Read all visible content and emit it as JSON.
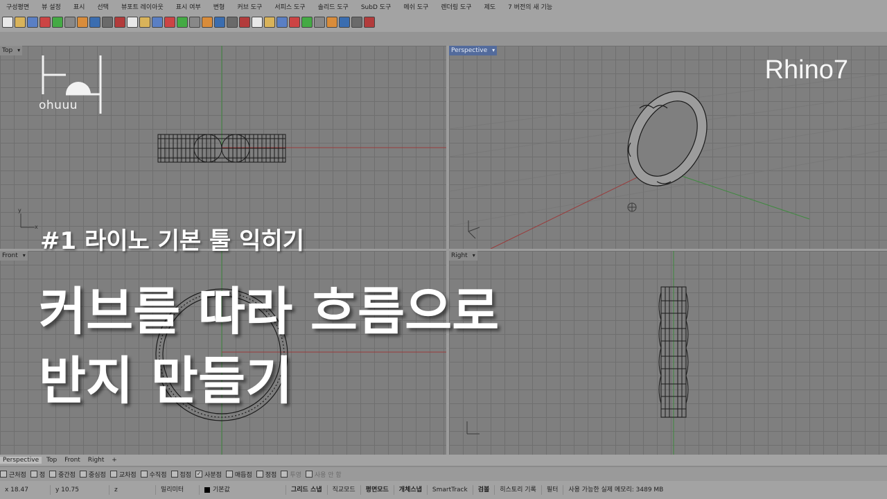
{
  "menu": [
    "구성평면",
    "뷰 설정",
    "표시",
    "선택",
    "뷰포트 레이아웃",
    "표시 여부",
    "변형",
    "커브 도구",
    "서피스 도구",
    "솔리드 도구",
    "SubD 도구",
    "메쉬 도구",
    "렌더링 도구",
    "제도",
    "7 버전의 새 기능"
  ],
  "toolbar_icons": [
    "new-icon",
    "open-icon",
    "save-icon",
    "print-icon",
    "cut-icon",
    "copy-icon",
    "paste-icon",
    "undo-icon",
    "pan-icon",
    "move-icon",
    "zoom-icon",
    "zoom-window-icon",
    "zoom-extents-icon",
    "zoom-selected-icon",
    "rotate-view-icon",
    "four-view-icon",
    "car-icon",
    "layer-icon",
    "properties-icon",
    "snap-icon",
    "light-icon",
    "render-icon",
    "material-icon",
    "shade-icon",
    "ghost-icon",
    "render-preview-icon",
    "filter-icon",
    "settings-icon",
    "options-icon",
    "help-icon"
  ],
  "viewports": {
    "top": "Top",
    "perspective": "Perspective",
    "front": "Front",
    "right": "Right"
  },
  "tabs": [
    "Perspective",
    "Top",
    "Front",
    "Right",
    "+"
  ],
  "osnaps": [
    {
      "label": "근처점",
      "checked": false
    },
    {
      "label": "점",
      "checked": false
    },
    {
      "label": "중간점",
      "checked": false
    },
    {
      "label": "중심점",
      "checked": false
    },
    {
      "label": "교차점",
      "checked": false
    },
    {
      "label": "수직점",
      "checked": false
    },
    {
      "label": "접점",
      "checked": false
    },
    {
      "label": "사분점",
      "checked": true
    },
    {
      "label": "매듭점",
      "checked": false
    },
    {
      "label": "정점",
      "checked": false
    },
    {
      "label": "투영",
      "checked": false,
      "dim": true
    },
    {
      "label": "사용 안 함",
      "checked": false,
      "dim": true
    }
  ],
  "status": {
    "x": "x 18.47",
    "y": "y 10.75",
    "z": "z",
    "unit": "밀리미터",
    "layer": "기본값",
    "grid_snap": "그리드 스냅",
    "ortho": "직교모드",
    "planar": "평면모드",
    "osnap": "개체스냅",
    "smarttrack": "SmartTrack",
    "gumball": "검볼",
    "history": "히스토리 기록",
    "filter": "필터",
    "memory": "사용 가능한 실제 메모리: 3489 MB"
  },
  "overlay": {
    "logo_text": "ohuuu",
    "rhino": "Rhino7",
    "subtitle": "#1 라이노 기본 툴 익히기",
    "title_line1": "커브를 따라 흐름으로",
    "title_line2": "반지 만들기"
  },
  "colors": {
    "grid_bg": "#7f7f7f",
    "grid_line": "#6f6f6f",
    "x_axis": "#9a3b3b",
    "y_axis": "#3e8a3e",
    "active_label": "#536b9c"
  }
}
